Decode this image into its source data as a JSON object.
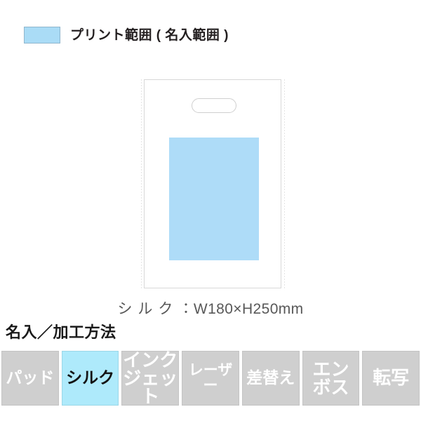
{
  "legend": {
    "swatch_color": "#aadcf6",
    "swatch_border_color": "#8fb6cd",
    "text": "プリント範囲 ( 名入範囲 )"
  },
  "product": {
    "name": "die-cut-handle-bag",
    "outline_color": "#d8d8d8",
    "fold_line_color": "#e4e4e4",
    "handle_shape": "rounded-rectangle",
    "print_area_color": "#aedcf8",
    "print_area_label": "print-area"
  },
  "dimension": {
    "method_kana": "シルク",
    "separator": "：",
    "value": "W180×H250mm",
    "full_text": "シルク：W180×H250mm"
  },
  "method_section": {
    "heading": "名入／加工方法",
    "active_color": "#aeeafb",
    "inactive_color": "#cfcfcf",
    "items": [
      {
        "id": "pad",
        "label": "パッド",
        "active": false,
        "lines": 1,
        "size": "md"
      },
      {
        "id": "silk",
        "label": "シルク",
        "active": true,
        "lines": 1,
        "size": "md"
      },
      {
        "id": "inkjet",
        "label": "インク\nジェット",
        "active": false,
        "lines": 2,
        "size": "two"
      },
      {
        "id": "laser",
        "label": "レーザー",
        "active": false,
        "lines": 1,
        "size": "sm"
      },
      {
        "id": "replacement",
        "label": "差替え",
        "active": false,
        "lines": 1,
        "size": "md"
      },
      {
        "id": "emboss",
        "label": "エン\nボス",
        "active": false,
        "lines": 2,
        "size": "two"
      },
      {
        "id": "transfer",
        "label": "転写",
        "active": false,
        "lines": 1,
        "size": "lg"
      }
    ]
  }
}
